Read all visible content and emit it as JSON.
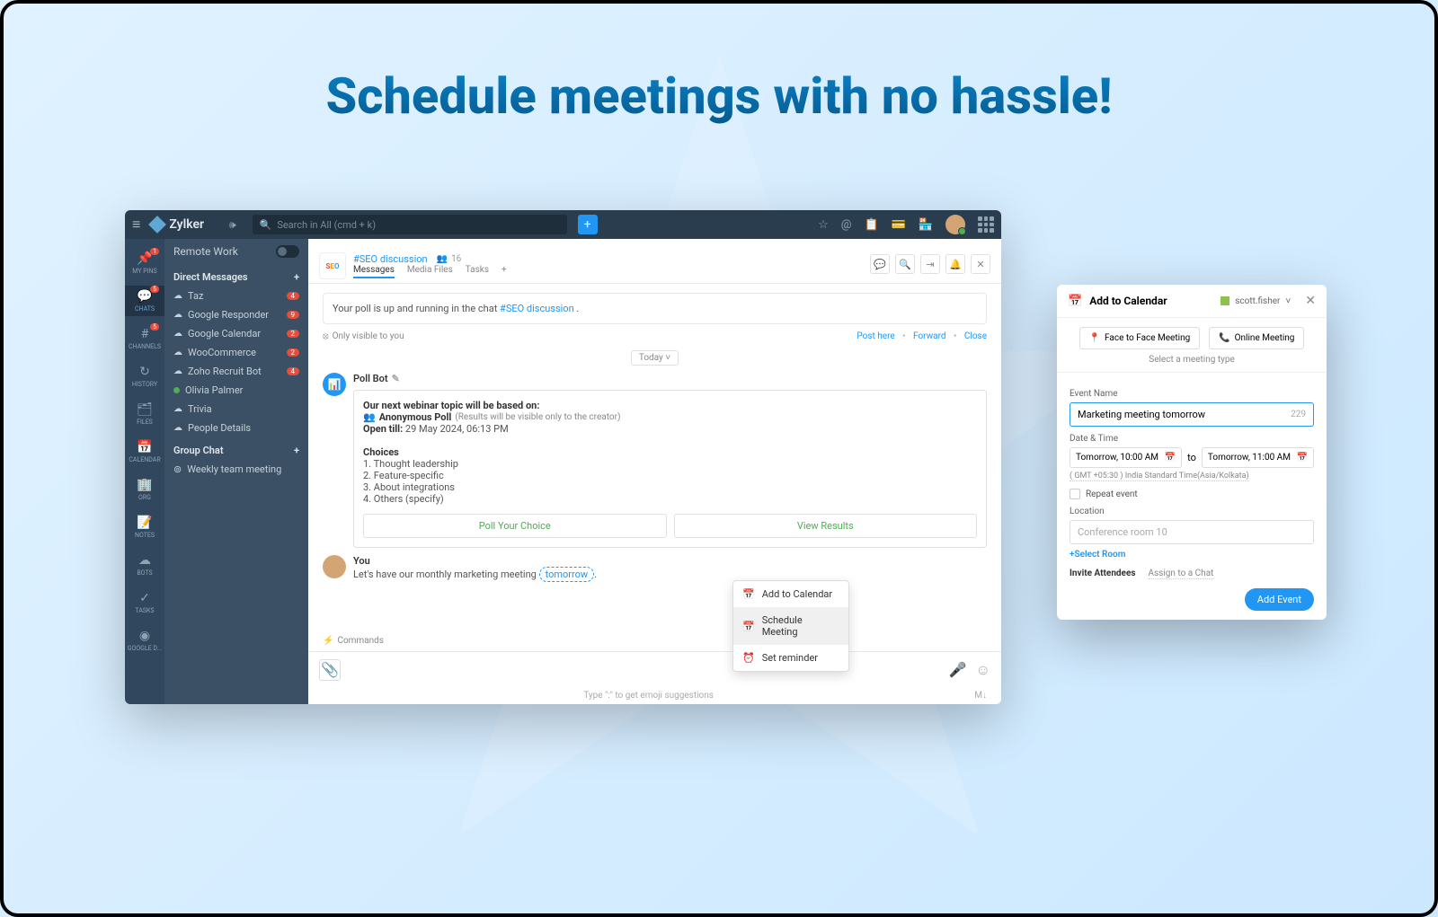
{
  "hero": {
    "title": "Schedule meetings with no hassle!"
  },
  "topbar": {
    "brand": "Zylker",
    "search_placeholder": "Search in All (cmd + k)"
  },
  "iconbar": [
    {
      "label": "MY PINS",
      "icon": "📌",
      "badge": "1"
    },
    {
      "label": "CHATS",
      "icon": "💬",
      "badge": "5",
      "active": true
    },
    {
      "label": "CHANNELS",
      "icon": "#",
      "badge": "5"
    },
    {
      "label": "HISTORY",
      "icon": "↻"
    },
    {
      "label": "FILES",
      "icon": "🗂"
    },
    {
      "label": "CALENDAR",
      "icon": "📅"
    },
    {
      "label": "ORG",
      "icon": "🏢"
    },
    {
      "label": "NOTES",
      "icon": "📝"
    },
    {
      "label": "BOTS",
      "icon": "☁"
    },
    {
      "label": "TASKS",
      "icon": "✓"
    },
    {
      "label": "GOOGLE D...",
      "icon": "◉"
    }
  ],
  "sidepanel": {
    "workspace": "Remote Work",
    "dm_header": "Direct Messages",
    "dms": [
      {
        "name": "Taz",
        "badge": "4",
        "cloud": true
      },
      {
        "name": "Google Responder",
        "badge": "9",
        "cloud": true
      },
      {
        "name": "Google Calendar",
        "badge": "2",
        "cloud": true
      },
      {
        "name": "WooCommerce",
        "badge": "2",
        "cloud": true
      },
      {
        "name": "Zoho Recruit Bot",
        "badge": "4",
        "cloud": true
      },
      {
        "name": "Olivia Palmer"
      },
      {
        "name": "Trivia",
        "cloud": true
      },
      {
        "name": "People Details",
        "cloud": true
      }
    ],
    "group_header": "Group Chat",
    "groups": [
      {
        "name": "Weekly team meeting"
      }
    ]
  },
  "chat": {
    "channel_name": "#SEO discussion",
    "people": "16",
    "tabs": {
      "messages": "Messages",
      "media": "Media Files",
      "tasks": "Tasks"
    },
    "notice_pre": "Your poll is up and running in the chat ",
    "notice_link": "#SEO discussion",
    "notice_post": " .",
    "visibility": "Only visible to you",
    "actions": {
      "post": "Post here",
      "forward": "Forward",
      "close": "Close"
    },
    "date": "Today",
    "pollbot_name": "Poll Bot",
    "poll": {
      "title": "Our next webinar topic will be based on:",
      "anon_label": "Anonymous Poll",
      "anon_note": " (Results will be visible only to the creator)",
      "open_label": "Open till: ",
      "open_value": "29 May 2024, 06:13 PM",
      "choices_label": "Choices",
      "choices": [
        "1. Thought leadership",
        "2. Feature-specific",
        "3. About integrations",
        "4. Others (specify)"
      ],
      "btn1": "Poll Your Choice",
      "btn2": "View Results"
    },
    "ctx_menu": {
      "add_cal": "Add to Calendar",
      "schedule": "Schedule Meeting",
      "reminder": "Set reminder"
    },
    "you": {
      "name": "You",
      "text_pre": "Let's have our monthly marketing meeting ",
      "text_tag": "tomorrow",
      "text_post": "."
    },
    "commands": "Commands",
    "emoji_hint": "Type \":\" to get emoji suggestions",
    "md": "M↓"
  },
  "calendar": {
    "title": "Add to Calendar",
    "user": "scott.fisher",
    "tab1": "Face to Face Meeting",
    "tab2": "Online Meeting",
    "subtitle": "Select a meeting type",
    "event_label": "Event Name",
    "event_value": "Marketing meeting tomorrow",
    "event_count": "229",
    "dt_label": "Date & Time",
    "dt_from": "Tomorrow, 10:00 AM",
    "dt_to_label": "to",
    "dt_to": "Tomorrow, 11:00 AM",
    "tz": "( GMT +05:30 ) India Standard Time(Asia/Kolkata)",
    "repeat": "Repeat event",
    "loc_label": "Location",
    "loc_placeholder": "Conference room 10",
    "select_room": "+Select Room",
    "invite_label": "Invite Attendees",
    "assign": "Assign to a Chat",
    "add_btn": "Add Event"
  }
}
